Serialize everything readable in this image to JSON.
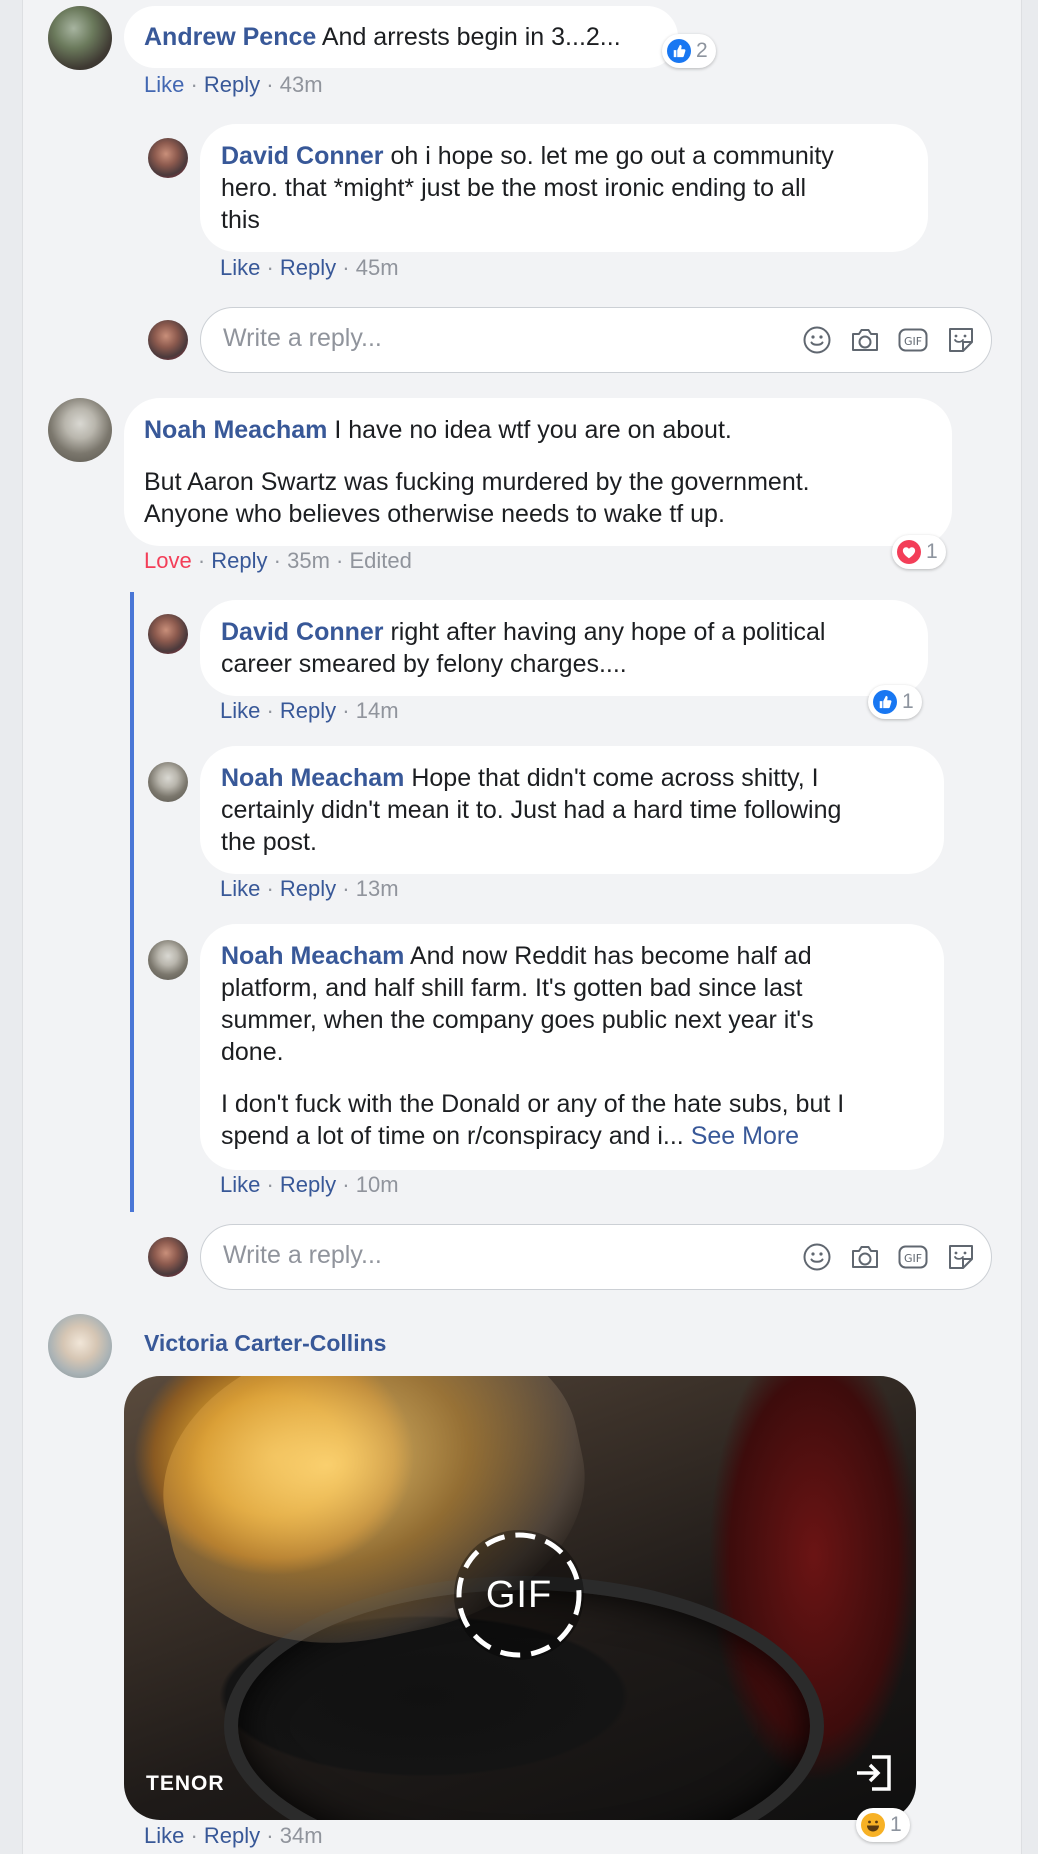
{
  "comments": [
    {
      "author": "Andrew Pence",
      "text": "And arrests begin in 3...2...",
      "actions": {
        "like": "Like",
        "reply": "Reply",
        "time": "43m"
      },
      "reaction": {
        "type": "like",
        "count": "2"
      }
    },
    {
      "author": "David Conner",
      "text_lines": [
        "oh i hope so. let me go out a community",
        "hero. that *might* just be the most ironic ending to all",
        "this"
      ],
      "actions": {
        "like": "Like",
        "reply": "Reply",
        "time": "45m"
      }
    },
    {
      "author": "Noah Meacham",
      "text": "I have no idea wtf you are on about.",
      "text2_lines": [
        "But Aaron Swartz was fucking murdered by the government.",
        "Anyone who believes otherwise needs to wake tf up."
      ],
      "actions": {
        "like": "Love",
        "reply": "Reply",
        "time": "35m",
        "edited": "Edited"
      },
      "reaction": {
        "type": "love",
        "count": "1"
      }
    },
    {
      "author": "David Conner",
      "text_lines": [
        "right after having any hope of a political",
        "career smeared by felony charges...."
      ],
      "actions": {
        "like": "Like",
        "reply": "Reply",
        "time": "14m"
      },
      "reaction": {
        "type": "like",
        "count": "1"
      }
    },
    {
      "author": "Noah Meacham",
      "text_lines": [
        "Hope that didn't come across shitty, I",
        "certainly didn't mean it to. Just had a hard time following",
        "the post."
      ],
      "actions": {
        "like": "Like",
        "reply": "Reply",
        "time": "13m"
      }
    },
    {
      "author": "Noah Meacham",
      "text_lines": [
        "And now Reddit has become half ad",
        "platform, and half shill farm. It's gotten bad since last",
        "summer, when the company goes public next year it's",
        "done."
      ],
      "text2_lines": [
        "I don't fuck with the Donald or any of the hate subs, but I",
        "spend a lot of time on r/conspiracy and i..."
      ],
      "see_more": "See More",
      "actions": {
        "like": "Like",
        "reply": "Reply",
        "time": "10m"
      }
    },
    {
      "author": "Victoria Carter-Collins",
      "gif": {
        "badge": "GIF",
        "provider": "TENOR"
      },
      "actions": {
        "like": "Like",
        "reply": "Reply",
        "time": "34m"
      },
      "reaction": {
        "type": "haha",
        "count": "1"
      }
    }
  ],
  "reply_box": {
    "placeholder": "Write a reply..."
  },
  "icons": [
    "emoji-icon",
    "camera-icon",
    "gif-icon",
    "sticker-icon"
  ],
  "colors": {
    "link": "#385898",
    "like_blue": "#4267b2",
    "love_red": "#f33e58",
    "thread_line": "#4a76d6"
  }
}
